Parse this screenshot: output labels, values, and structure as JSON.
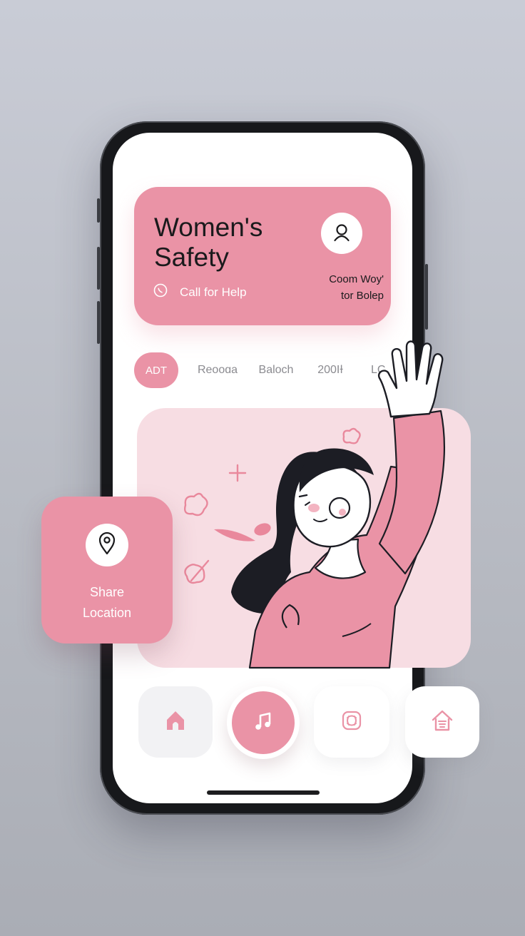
{
  "header": {
    "title": "Women's Safety",
    "call_label": "Call for Help",
    "side_text_line1": "Coom Woy'",
    "side_text_line2": "tor Bolep"
  },
  "tabs": [
    {
      "label": "ADT",
      "active": true
    },
    {
      "label": "Reooɑa",
      "active": false
    },
    {
      "label": "Baloch",
      "active": false
    },
    {
      "label": "200ΙƗ",
      "active": false
    },
    {
      "label": "LC",
      "active": false
    }
  ],
  "share_card": {
    "label_line1": "Share",
    "label_line2": "Location"
  },
  "bottom_nav": [
    {
      "icon": "home-icon"
    },
    {
      "icon": "music-note-icon",
      "active": true
    },
    {
      "icon": "pattern-icon"
    },
    {
      "icon": "shelter-home-icon"
    }
  ],
  "colors": {
    "accent_pink": "#ea93a6",
    "light_pink": "#f7dde3",
    "ink": "#1a1a1c",
    "hair": "#1c1d24"
  }
}
